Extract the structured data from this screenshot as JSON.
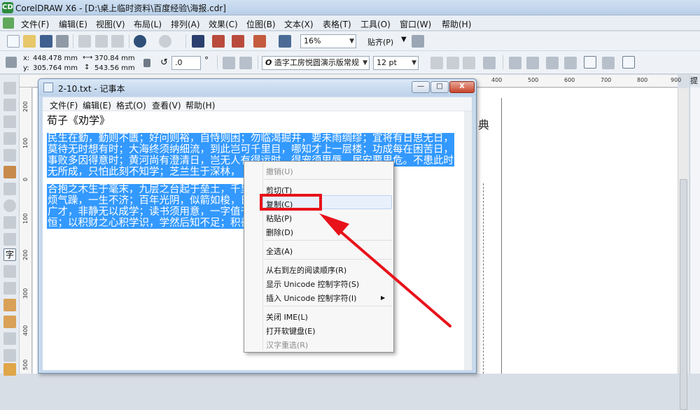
{
  "app": {
    "title": "CorelDRAW X6 - [D:\\桌上临时资料\\百度经验\\海报.cdr]",
    "logo": "CD"
  },
  "menubar": [
    "文件(F)",
    "编辑(E)",
    "视图(V)",
    "布局(L)",
    "排列(A)",
    "效果(C)",
    "位图(B)",
    "文本(X)",
    "表格(T)",
    "工具(O)",
    "窗口(W)",
    "帮助(H)"
  ],
  "toolbar": {
    "zoom": "16%",
    "snap": "贴齐(P)"
  },
  "propbar": {
    "x_label": "x:",
    "x_value": "448.478 mm",
    "y_label": "y:",
    "y_value": "305.764 mm",
    "width_value": "370.84 mm",
    "height_value": "543.56 mm",
    "rotation": ".0",
    "degree": "°",
    "font_name": "造字工房悦圆演示版常规",
    "font_size": "12 pt",
    "font_glyph": "O"
  },
  "ruler": {
    "h_ticks": [
      "400",
      "500",
      "600",
      "700",
      "800",
      "900"
    ],
    "v_ticks": [
      "200",
      "100",
      "0",
      "100",
      "200",
      "300",
      "400",
      "500"
    ]
  },
  "canvas": {
    "text": "典"
  },
  "docker": {
    "tab": "提"
  },
  "notepad": {
    "title": "2-10.txt - 记事本",
    "menu": [
      "文件(F)",
      "编辑(E)",
      "格式(O)",
      "查看(V)",
      "帮助(H)"
    ],
    "controls": {
      "minimize": "—",
      "maximize": "□",
      "close": "X"
    },
    "heading": "荀子《劝学》",
    "paragraph1": [
      "民生在勤，勤则不匮；好问则裕，自恃则困；勿临渴掘井，要未雨绸缪；宜将有日思无日，",
      "莫待无时想有时；大海终须纳细流，到此岂可千里目，哪知才上一层楼；功成每在困苦日，",
      "事败多因得意时；黄河尚有澄清日，岂无人有得运时，得宠须思辱，居安要思危。不患此时",
      "无所成，只怕此刻不知学；芝兰生于深林，                                                                                   穷因而改志。"
    ],
    "paragraph2": [
      "合抱之木生于毫末，九层之台起于垒土，千里                                              烦莫使气；心",
      "烦气躁，一生不济；百年光阴，似箭如梭，日                                              非；非学无以",
      "广才，非静无以成学；读书须用意，一字值千                                              言有物而行有",
      "恒；以积财之心积学识，学然后知不足；积善                                              得！"
    ]
  },
  "context_menu": {
    "undo": "撤销(U)",
    "cut": "剪切(T)",
    "copy": "复制(C)",
    "paste": "粘贴(P)",
    "delete": "删除(D)",
    "select_all": "全选(A)",
    "rtl": "从右到左的阅读顺序(R)",
    "show_unicode": "显示 Unicode 控制字符(S)",
    "insert_unicode": "插入 Unicode 控制字符(I)",
    "close_ime": "关闭 IME(L)",
    "soft_keyboard": "打开软键盘(E)",
    "reconversion": "汉字重选(R)"
  },
  "colors": {
    "selection": "#3399ff",
    "highlight": "#e8121a",
    "arrow": "#e8121a"
  }
}
